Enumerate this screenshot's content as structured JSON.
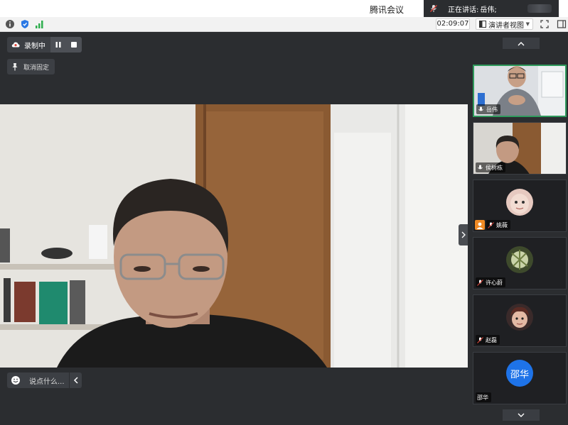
{
  "window": {
    "title": "腾讯会议",
    "speaking_label": "正在讲话:",
    "speaking_name": "岳伟;"
  },
  "status": {
    "timer": "02:09:07",
    "view_mode": "演讲者视图"
  },
  "toolbar": {
    "recording_label": "录制中",
    "unpin_label": "取消固定"
  },
  "chat": {
    "placeholder": "说点什么..."
  },
  "participants": [
    {
      "name": "岳伟",
      "type": "video",
      "speaking": true
    },
    {
      "name": "侯树栋",
      "type": "video",
      "speaking": false
    },
    {
      "name": "姚薇",
      "type": "avatar",
      "host": true
    },
    {
      "name": "许心蔚",
      "type": "avatar"
    },
    {
      "name": "赵磊",
      "type": "avatar"
    },
    {
      "name": "邵华",
      "type": "text-avatar",
      "avatar_text": "邵华"
    }
  ],
  "colors": {
    "active_border": "#2f9a5c",
    "host_badge": "#f08a24",
    "text_avatar_bg": "#1e73e8",
    "network_green": "#2fae4e"
  }
}
